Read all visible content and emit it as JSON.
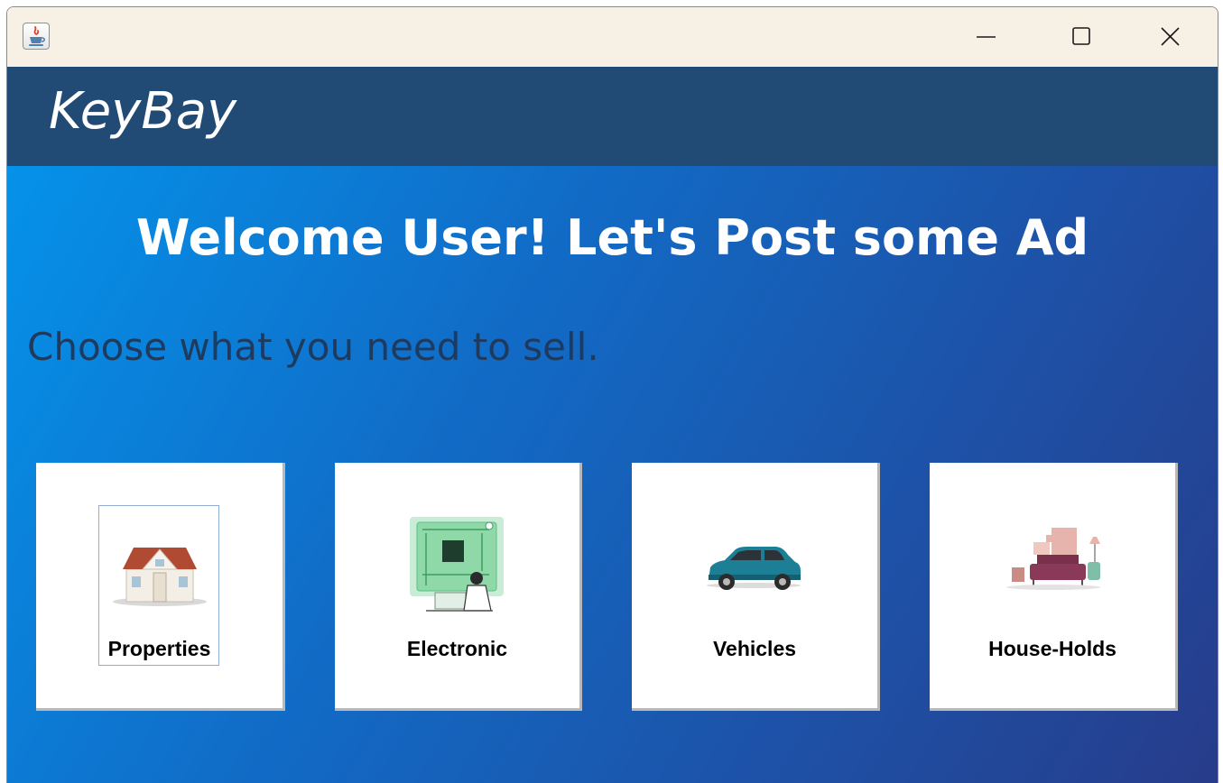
{
  "app": {
    "brand": "KeyBay"
  },
  "main": {
    "welcome": "Welcome User! Let's Post some Ad",
    "subtitle": "Choose what you need to sell."
  },
  "categories": [
    {
      "label": "Properties",
      "icon": "house-icon",
      "focused": true
    },
    {
      "label": "Electronic",
      "icon": "circuit-board-icon",
      "focused": false
    },
    {
      "label": "Vehicles",
      "icon": "car-icon",
      "focused": false
    },
    {
      "label": "House-Holds",
      "icon": "sofa-icon",
      "focused": false
    }
  ],
  "colors": {
    "titlebar": "#f7f0e5",
    "header": "#214a74",
    "gradient_start": "#0592e9",
    "gradient_end": "#273c8a",
    "subtitle": "#1e3a5f"
  }
}
